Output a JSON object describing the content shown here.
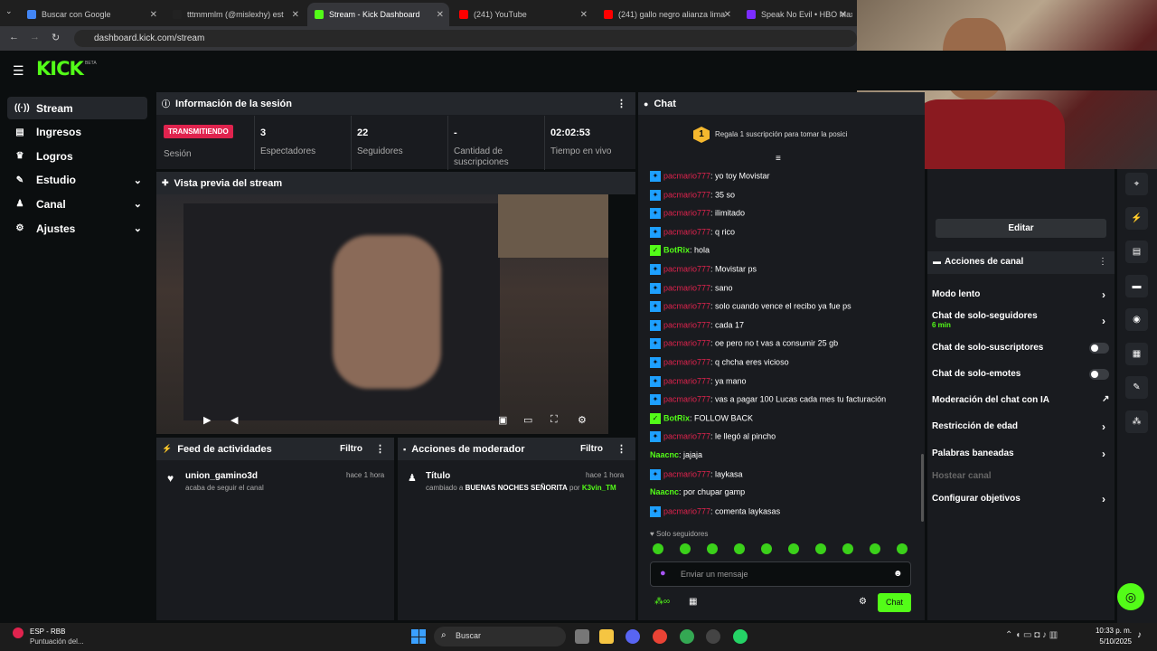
{
  "browser": {
    "tabs": [
      {
        "title": "Buscar con Google",
        "color": "#4285f4"
      },
      {
        "title": "tttmmmlm (@mislexhy) est",
        "color": "#222222"
      },
      {
        "title": "Stream - Kick Dashboard",
        "color": "#53fc18"
      },
      {
        "title": "(241) YouTube",
        "color": "#ff0000"
      },
      {
        "title": "(241) gallo negro alianza lima",
        "color": "#ff0000"
      },
      {
        "title": "Speak No Evil • HBO Max",
        "color": "#7b2cff"
      }
    ],
    "url": "dashboard.kick.com/stream"
  },
  "brand": {
    "logo": "KICK",
    "beta": "BETA",
    "accent": "#53fc18"
  },
  "sidebar": {
    "items": [
      {
        "label": "Stream",
        "icon": "broadcast-icon",
        "glyph": "((·))"
      },
      {
        "label": "Ingresos",
        "icon": "money-icon",
        "glyph": "▤"
      },
      {
        "label": "Logros",
        "icon": "trophy-icon",
        "glyph": "♛"
      },
      {
        "label": "Estudio",
        "icon": "studio-icon",
        "glyph": "✎"
      },
      {
        "label": "Canal",
        "icon": "channel-icon",
        "glyph": "♟"
      },
      {
        "label": "Ajustes",
        "icon": "gear-icon",
        "glyph": "⚙"
      }
    ]
  },
  "session": {
    "title": "Información de la sesión",
    "status": "TRANSMITIENDO",
    "status_label": "Sesión",
    "stats": [
      {
        "value": "3",
        "label": "Espectadores"
      },
      {
        "value": "22",
        "label": "Seguidores"
      },
      {
        "value": "-",
        "label": "Cantidad de suscripciones"
      },
      {
        "value": "02:02:53",
        "label": "Tiempo en vivo"
      }
    ]
  },
  "preview": {
    "title": "Vista previa del stream"
  },
  "feed": {
    "title": "Feed de actividades",
    "filter": "Filtro",
    "user": "union_gamino3d",
    "time": "hace 1 hora",
    "text": "acaba de seguir el canal"
  },
  "mod": {
    "title": "Acciones de moderador",
    "filter": "Filtro",
    "label": "Título",
    "time": "hace 1 hora",
    "pre": "cambiado a",
    "bold": "BUENAS NOCHES SEÑORITA",
    "por": "por",
    "user": "K3vin_TM"
  },
  "chat": {
    "title": "Chat",
    "gift_count": "1",
    "gift_text": "Regala 1 suscripción para tomar la posici",
    "messages": [
      {
        "user": "pacmario777",
        "text": ": yo toy Movistar",
        "badge": "sub"
      },
      {
        "user": "pacmario777",
        "text": ": 35 so",
        "badge": "sub"
      },
      {
        "user": "pacmario777",
        "text": ": ilimitado",
        "badge": "sub"
      },
      {
        "user": "pacmario777",
        "text": ": q rico",
        "badge": "sub"
      },
      {
        "user": "BotRix",
        "text": ": hola",
        "badge": "bot"
      },
      {
        "user": "pacmario777",
        "text": ": Movistar ps",
        "badge": "sub"
      },
      {
        "user": "pacmario777",
        "text": ": sano",
        "badge": "sub"
      },
      {
        "user": "pacmario777",
        "text": ": solo cuando vence el recibo ya fue ps",
        "badge": "sub"
      },
      {
        "user": "pacmario777",
        "text": ": cada 17",
        "badge": "sub"
      },
      {
        "user": "pacmario777",
        "text": ": oe pero no t vas a consumir 25 gb",
        "badge": "sub"
      },
      {
        "user": "pacmario777",
        "text": ": q chcha eres vicioso",
        "badge": "sub"
      },
      {
        "user": "pacmario777",
        "text": ": ya mano",
        "badge": "sub"
      },
      {
        "user": "pacmario777",
        "text": ": vas a pagar 100 Lucas cada mes tu facturación",
        "badge": "sub"
      },
      {
        "user": "BotRix",
        "text": ": FOLLOW BACK",
        "badge": "bot"
      },
      {
        "user": "pacmario777",
        "text": ": le llegó al pincho",
        "badge": "sub"
      },
      {
        "user": "Naacnc",
        "text": ": jajaja",
        "badge": "none"
      },
      {
        "user": "pacmario777",
        "text": ": laykasa",
        "badge": "sub"
      },
      {
        "user": "Naacnc",
        "text": ": por chupar gamp",
        "badge": "none"
      },
      {
        "user": "pacmario777",
        "text": ": comenta laykasas",
        "badge": "sub"
      }
    ],
    "followers_only": "Solo seguidores",
    "placeholder": "Enviar un mensaje",
    "send": "Chat"
  },
  "channel_actions": {
    "edit": "Editar",
    "title": "Acciones de canal",
    "items": [
      {
        "label": "Modo lento",
        "control": "arrow"
      },
      {
        "label": "Chat de solo-seguidores",
        "sub": "6 min",
        "control": "arrow"
      },
      {
        "label": "Chat de solo-suscriptores",
        "control": "toggle"
      },
      {
        "label": "Chat de solo-emotes",
        "control": "toggle"
      },
      {
        "label": "Moderación del chat con IA",
        "control": "external"
      },
      {
        "label": "Restricción de edad",
        "control": "arrow"
      },
      {
        "label": "Palabras baneadas",
        "control": "arrow"
      },
      {
        "label": "Hostear canal",
        "control": "none",
        "disabled": true
      },
      {
        "label": "Configurar objetivos",
        "control": "arrow"
      }
    ]
  },
  "taskbar": {
    "lang": "ESP - RBB",
    "lang_sub": "Puntuación del...",
    "search": "Buscar",
    "time": "10:33 p. m.",
    "date": "5/10/2025"
  }
}
